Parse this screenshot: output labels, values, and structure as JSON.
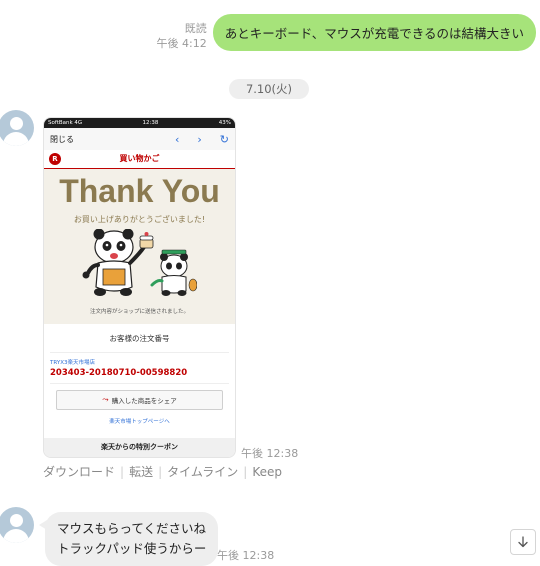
{
  "sent_message": {
    "read_label": "既読",
    "time": "午後 4:12",
    "text": "あとキーボード、マウスが充電できるのは結構大きい"
  },
  "date_separator": "7.10(火)",
  "screenshot_card": {
    "status": {
      "carrier": "SoftBank  4G",
      "time": "12:38",
      "battery": "43%"
    },
    "browser": {
      "close_label": "閉じる",
      "back": "‹",
      "forward": "›",
      "reload": "↻"
    },
    "cart": {
      "logo_letter": "R",
      "title": "買い物かご"
    },
    "thanks": {
      "headline": "Thank You",
      "subtitle": "お買い上げありがとうございました!",
      "sent_note": "注文内容がショップに送信されました。"
    },
    "order": {
      "heading": "お客様の注文番号",
      "shop": "TRYX3楽天市場店",
      "number": "203403-20180710-00598820",
      "share_button": "購入した商品をシェア",
      "top_link": "楽天市場トップページへ"
    },
    "coupon": "楽天からの特別クーポン",
    "time": "午後 12:38"
  },
  "actions": {
    "download": "ダウンロード",
    "forward": "転送",
    "timeline": "タイムライン",
    "keep": "Keep"
  },
  "received_message": {
    "lines": [
      "マウスもらってくださいね",
      "トラックパッド使うからー"
    ],
    "time": "午後 12:38"
  },
  "colors": {
    "sent_bubble": "#a6e37a",
    "received_bubble": "#eeeeee",
    "rakuten_red": "#bf0000",
    "thank_you_gold": "#8b7a50"
  }
}
